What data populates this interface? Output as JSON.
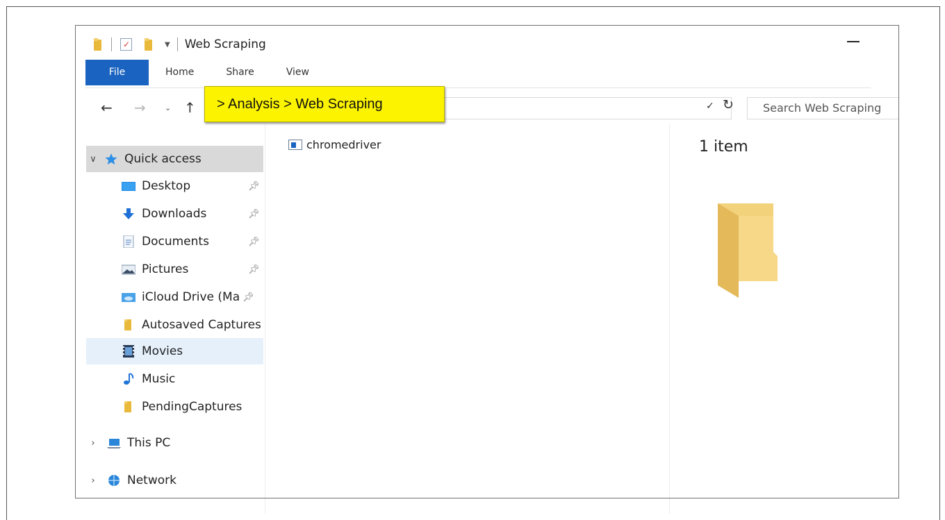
{
  "window": {
    "title": "Web Scraping"
  },
  "ribbon": {
    "tabs": [
      "File",
      "Home",
      "Share",
      "View"
    ]
  },
  "address": {
    "callout_text": "> Analysis > Web Scraping",
    "search_placeholder": "Search Web Scraping"
  },
  "sidebar": {
    "quick_access": "Quick access",
    "items": [
      {
        "label": "Desktop",
        "icon": "desktop-icon",
        "pinned": true
      },
      {
        "label": "Downloads",
        "icon": "downloads-icon",
        "pinned": true
      },
      {
        "label": "Documents",
        "icon": "documents-icon",
        "pinned": true
      },
      {
        "label": "Pictures",
        "icon": "pictures-icon",
        "pinned": true
      },
      {
        "label": "iCloud Drive (Ma",
        "icon": "icloud-icon",
        "pinned": true
      },
      {
        "label": "Autosaved Captures",
        "icon": "folder-icon",
        "pinned": false
      },
      {
        "label": "Movies",
        "icon": "movies-icon",
        "pinned": false
      },
      {
        "label": "Music",
        "icon": "music-icon",
        "pinned": false
      },
      {
        "label": "PendingCaptures",
        "icon": "folder-icon",
        "pinned": false
      }
    ],
    "this_pc": "This PC",
    "network": "Network"
  },
  "files": [
    {
      "name": "chromedriver",
      "icon": "exe-icon"
    }
  ],
  "details": {
    "item_count": "1 item"
  },
  "colors": {
    "file_tab": "#1a63c0",
    "callout": "#fcf300",
    "selected_blue": "#e5f0fb",
    "selected_grey": "#d9d9d9",
    "folder": "#f5d57a"
  }
}
